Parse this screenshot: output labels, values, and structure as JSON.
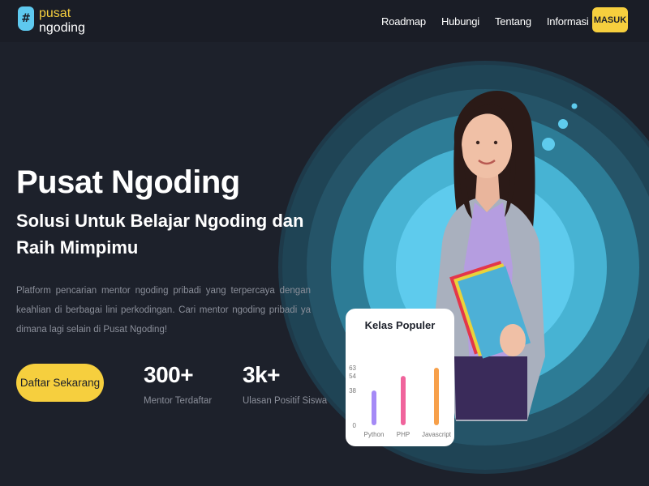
{
  "header": {
    "logo": {
      "line1": "pusat",
      "line2": "ngoding",
      "icon": "hash-chat-icon"
    },
    "nav": [
      "Roadmap",
      "Hubungi",
      "Tentang",
      "Informasi"
    ],
    "theme_icon": "sun-icon",
    "login_label": "MASUK"
  },
  "hero": {
    "title": "Pusat Ngoding",
    "subtitle": "Solusi Untuk Belajar Ngoding dan Raih Mimpimu",
    "description": "Platform pencarian mentor ngoding pribadi yang terpercaya dengan keahlian di berbagai lini perkodingan. Cari mentor ngoding pribadi ya dimana lagi selain di Pusat Ngoding!",
    "cta_label": "Daftar Sekarang",
    "stats": [
      {
        "value": "300+",
        "label": "Mentor Terdaftar"
      },
      {
        "value": "3k+",
        "label": "Ulasan Positif Siswa"
      }
    ]
  },
  "colors": {
    "accent": "#f6cf3e",
    "background": "#1d212b",
    "brand_blue": "#5ec9ef"
  },
  "card": {
    "title": "Kelas Populer"
  },
  "chart_data": {
    "type": "bar",
    "categories": [
      "Python",
      "PHP",
      "Javascript"
    ],
    "values": [
      38,
      54,
      63
    ],
    "yticks": [
      0,
      38,
      54,
      63
    ],
    "colors": [
      "#a58af6",
      "#f0649c",
      "#f7a04a"
    ]
  }
}
